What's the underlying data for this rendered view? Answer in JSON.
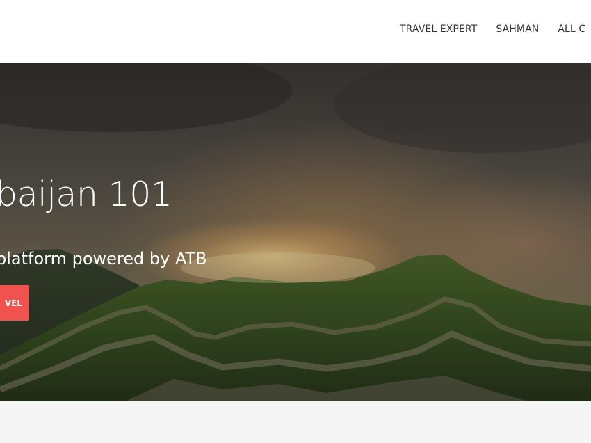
{
  "nav": {
    "items": [
      "TRAVEL EXPERT",
      "SAHMAN",
      "ALL C"
    ]
  },
  "hero": {
    "title": "baijan 101",
    "subtitle": "platform powered by ATB",
    "cta_label": "VEL",
    "cta_color": "#f0524d"
  }
}
